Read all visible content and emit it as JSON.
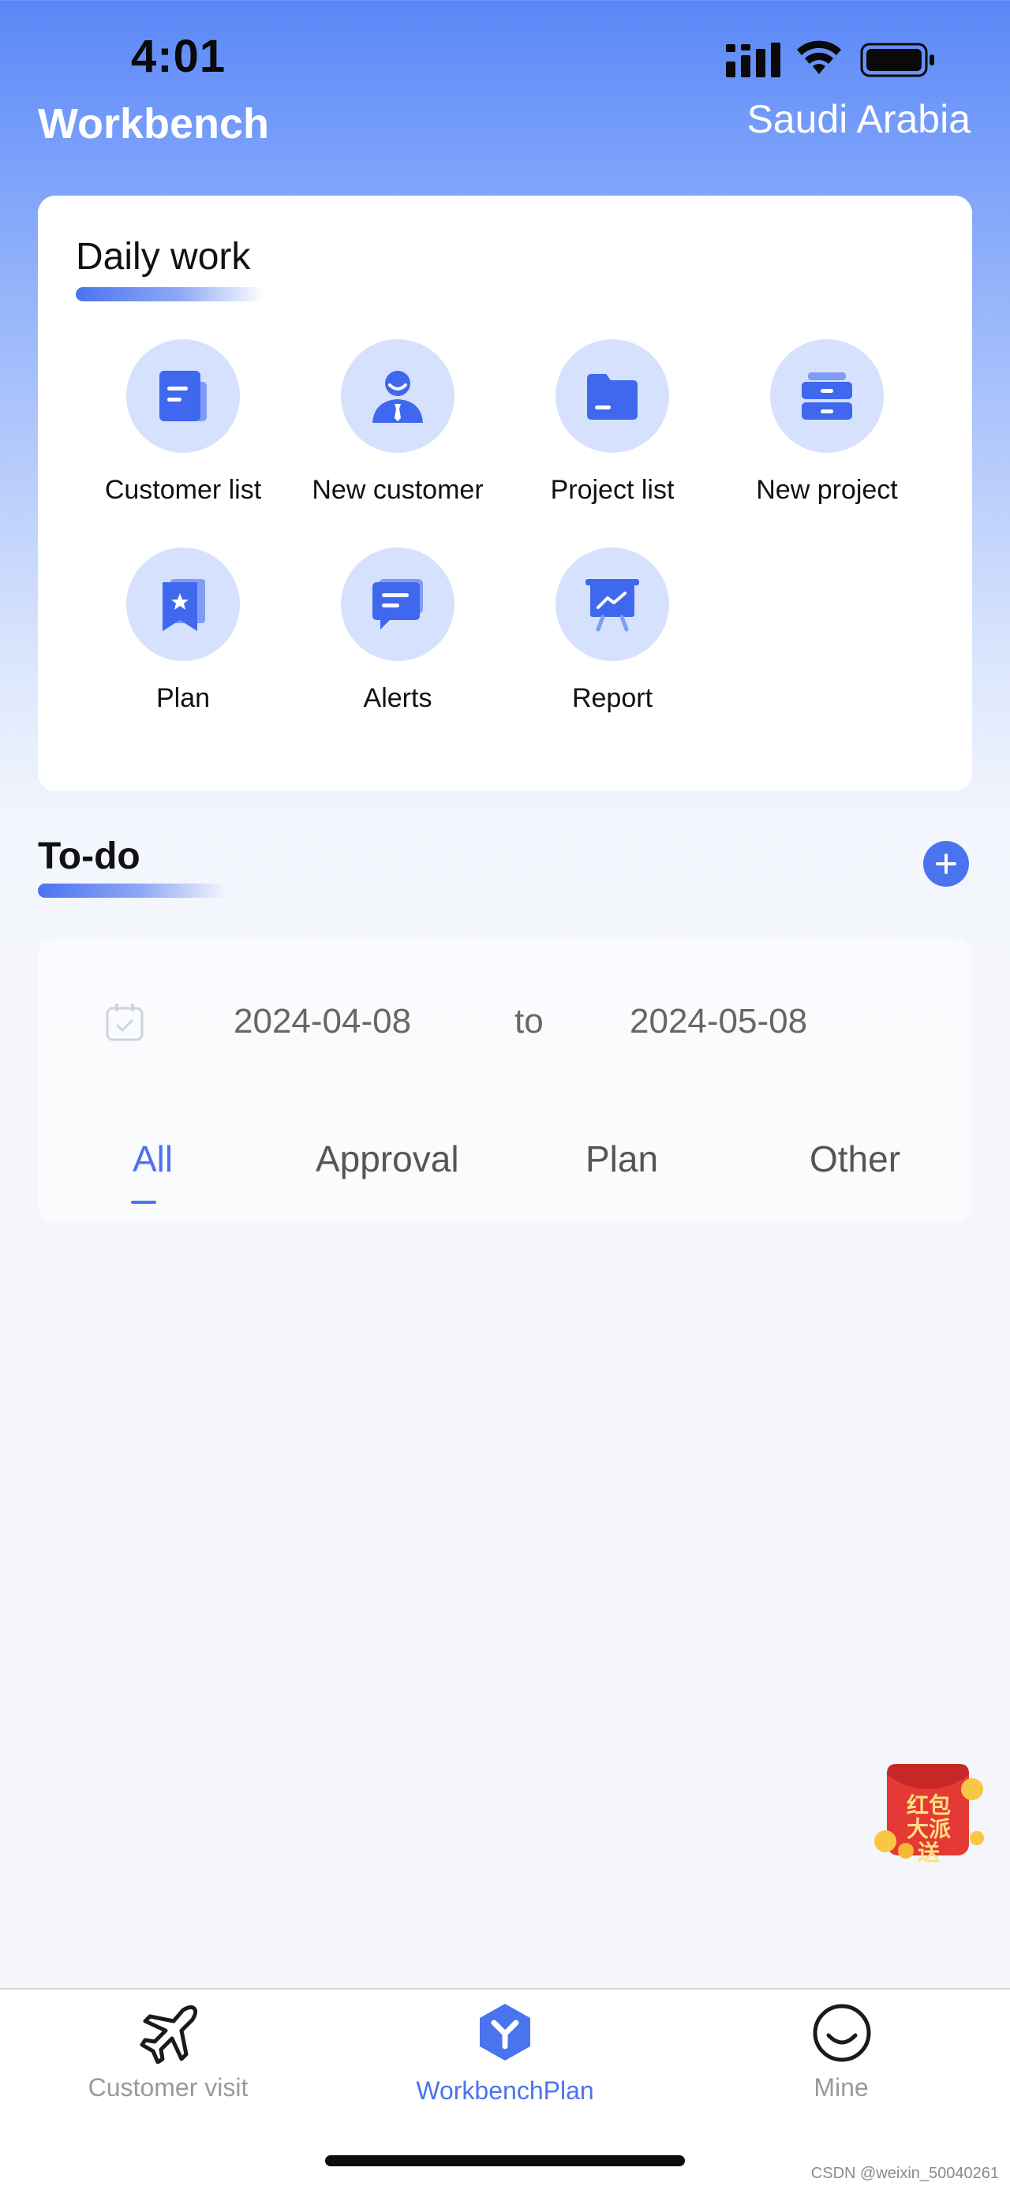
{
  "status_bar": {
    "time": "4:01"
  },
  "header": {
    "title": "Workbench",
    "region": "Saudi Arabia"
  },
  "daily_work": {
    "title": "Daily work",
    "items": [
      {
        "label": "Customer list",
        "icon": "customer-list-icon"
      },
      {
        "label": "New customer",
        "icon": "new-customer-icon"
      },
      {
        "label": "Project list",
        "icon": "folder-icon"
      },
      {
        "label": "New project",
        "icon": "drawer-icon"
      },
      {
        "label": "Plan",
        "icon": "bookmark-star-icon"
      },
      {
        "label": "Alerts",
        "icon": "message-icon"
      },
      {
        "label": "Report",
        "icon": "presentation-chart-icon"
      }
    ]
  },
  "todo": {
    "title": "To-do",
    "date_from": "2024-04-08",
    "date_sep": "to",
    "date_to": "2024-05-08",
    "tabs": [
      "All",
      "Approval",
      "Plan",
      "Other"
    ],
    "active_tab": "All"
  },
  "promo": {
    "text": "红包大派送"
  },
  "bottom_nav": {
    "items": [
      {
        "label": "Customer visit",
        "icon": "airplane-icon"
      },
      {
        "label": "WorkbenchPlan",
        "icon": "workbench-hex-icon"
      },
      {
        "label": "Mine",
        "icon": "smile-icon"
      }
    ],
    "active": "WorkbenchPlan"
  },
  "watermark": "CSDN @weixin_50040261",
  "colors": {
    "accent": "#4a73f0",
    "icon_bg": "#d6e2fd",
    "header_blue": "#5a87f7"
  }
}
